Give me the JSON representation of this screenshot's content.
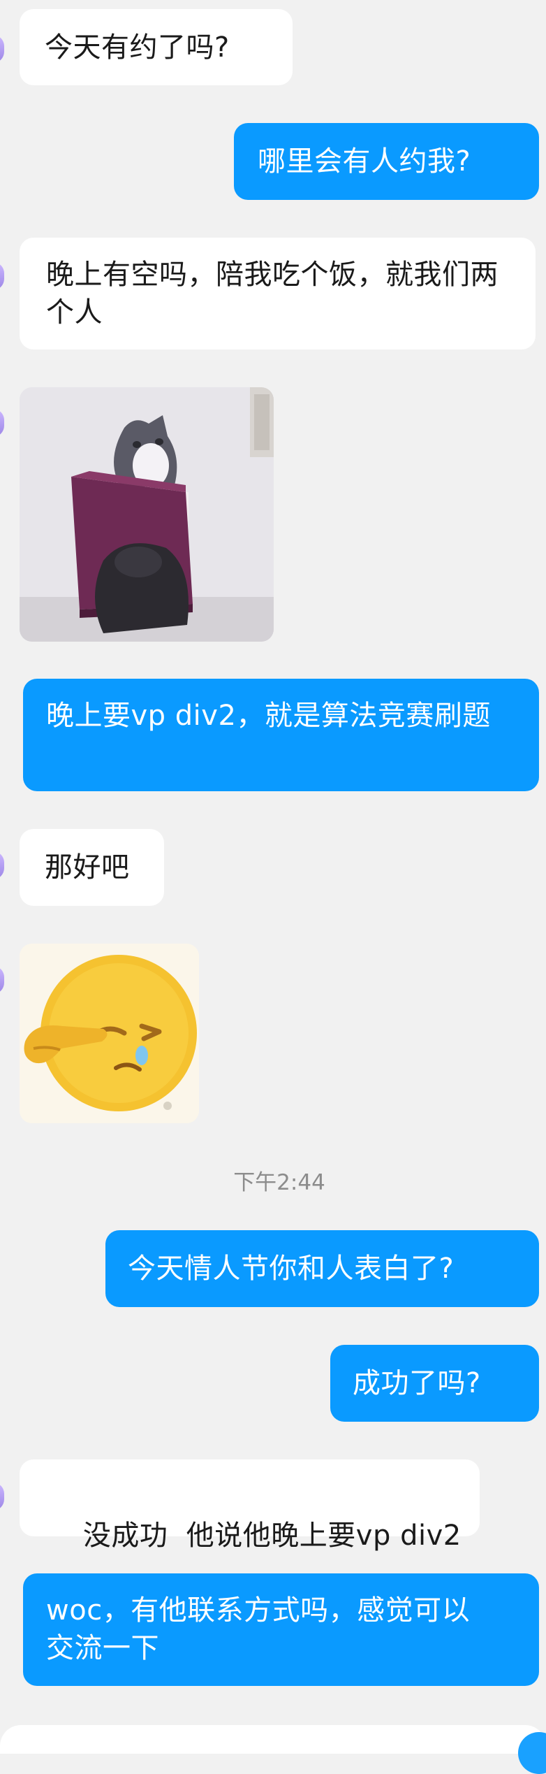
{
  "chat": {
    "messages": [
      {
        "side": "in",
        "text": "今天有约了吗?"
      },
      {
        "side": "out",
        "text": "哪里会有人约我?"
      },
      {
        "side": "in",
        "text": "晚上有空吗，陪我吃个饭，就我们两个人"
      },
      {
        "side": "in",
        "sticker": "cat-in-box-sticker"
      },
      {
        "side": "out",
        "text": "晚上要vp div2，就是算法竞赛刷题"
      },
      {
        "side": "in",
        "text": "那好吧"
      },
      {
        "side": "in",
        "sticker": "crying-face-emoji-sticker"
      },
      {
        "timestamp": "下午2:44"
      },
      {
        "side": "out",
        "text": "今天情人节你和人表白了?"
      },
      {
        "side": "out",
        "text": "成功了吗?"
      },
      {
        "side": "in",
        "text": "没成功  他说他晚上要vp div2"
      },
      {
        "side": "out",
        "text": "woc，有他联系方式吗，感觉可以交流一下"
      }
    ]
  },
  "colors": {
    "background": "#f1f1f1",
    "incoming_bubble": "#ffffff",
    "outgoing_bubble": "#0a9aff",
    "timestamp_text": "#8c8c8c"
  }
}
